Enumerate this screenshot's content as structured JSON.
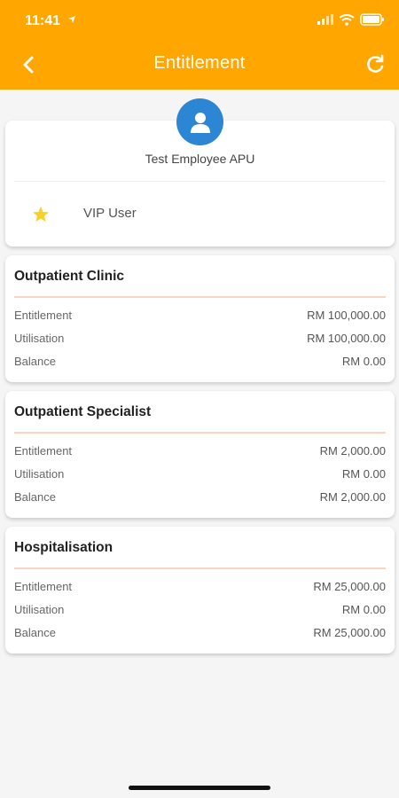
{
  "status_bar": {
    "time": "11:41"
  },
  "header": {
    "title": "Entitlement"
  },
  "profile": {
    "name": "Test Employee  APU",
    "badge_label": "VIP User"
  },
  "benefits": [
    {
      "title": "Outpatient Clinic",
      "rows": [
        {
          "label": "Entitlement",
          "value": "RM 100,000.00"
        },
        {
          "label": "Utilisation",
          "value": "RM 100,000.00"
        },
        {
          "label": "Balance",
          "value": "RM 0.00"
        }
      ]
    },
    {
      "title": "Outpatient Specialist",
      "rows": [
        {
          "label": "Entitlement",
          "value": "RM 2,000.00"
        },
        {
          "label": "Utilisation",
          "value": "RM 0.00"
        },
        {
          "label": "Balance",
          "value": "RM 2,000.00"
        }
      ]
    },
    {
      "title": "Hospitalisation",
      "rows": [
        {
          "label": "Entitlement",
          "value": "RM 25,000.00"
        },
        {
          "label": "Utilisation",
          "value": "RM 0.00"
        },
        {
          "label": "Balance",
          "value": "RM 25,000.00"
        }
      ]
    }
  ],
  "colors": {
    "header_bg": "#ffa600",
    "avatar_bg": "#2d86d3",
    "star": "#f5d22b",
    "accent_line": "#f7d3c2"
  },
  "icons": {
    "back": "chevron-left-icon",
    "refresh": "refresh-icon",
    "avatar": "user-icon",
    "vip": "star-icon",
    "location": "location-arrow-icon",
    "signal": "signal-icon",
    "wifi": "wifi-icon",
    "battery": "battery-icon"
  }
}
